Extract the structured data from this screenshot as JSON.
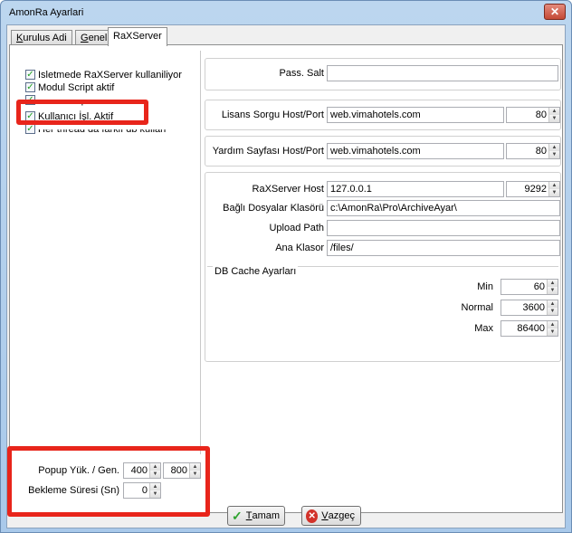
{
  "window": {
    "title": "AmonRa Ayarlari",
    "close_glyph": "✕"
  },
  "tabs": [
    {
      "label_u": "K",
      "label_rest": "urulus Adi"
    },
    {
      "label_u": "G",
      "label_rest": "enel"
    },
    {
      "label": "RaXServer"
    }
  ],
  "options": [
    {
      "label": "Isletmede RaXServer kullaniliyor",
      "checked": true
    },
    {
      "label": "Modul Script aktif",
      "checked": true
    },
    {
      "label": "Form Scripleri aktif",
      "checked": true
    },
    {
      "label": "Kullanıcı İşl. Aktif",
      "checked": true
    },
    {
      "label": "Her thread da farklı db kullan",
      "checked": true
    }
  ],
  "check_glyph": "✓",
  "pass_salt": {
    "label": "Pass. Salt",
    "value": ""
  },
  "lisans": {
    "label": "Lisans Sorgu Host/Port",
    "host": "web.vimahotels.com",
    "port": "80"
  },
  "yardim": {
    "label": "Yardım Sayfası Host/Port",
    "host": "web.vimahotels.com",
    "port": "80"
  },
  "raxserver": {
    "host_label": "RaXServer Host",
    "host": "127.0.0.1",
    "port": "9292",
    "folder_label": "Bağlı Dosyalar Klasörü",
    "folder": "c:\\AmonRa\\Pro\\ArchiveAyar\\",
    "upload_label": "Upload Path",
    "upload": "",
    "ana_label": "Ana Klasor",
    "ana": "/files/"
  },
  "db_cache": {
    "title": "DB Cache Ayarları",
    "min_label": "Min",
    "min": "60",
    "normal_label": "Normal",
    "normal": "3600",
    "max_label": "Max",
    "max": "86400"
  },
  "popup": {
    "label": "Popup Yük. / Gen.",
    "height": "400",
    "width": "800"
  },
  "bekleme": {
    "label": "Bekleme Süresi (Sn)",
    "value": "0"
  },
  "buttons": {
    "ok_u": "T",
    "ok_rest": "amam",
    "cancel_u": "V",
    "cancel_rest": "azgeç"
  },
  "colors": {
    "highlight": "#e8251b",
    "check": "#21a121"
  }
}
